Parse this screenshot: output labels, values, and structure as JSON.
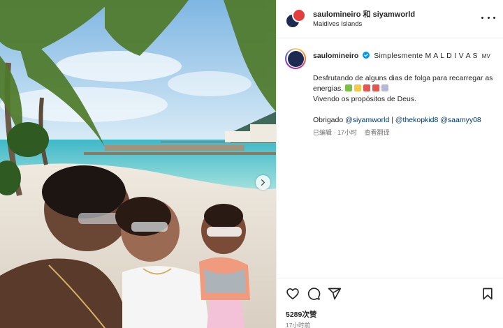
{
  "header": {
    "user1": "saulomineiro",
    "connector": "和",
    "user2": "siyamworld",
    "location": "Maldives Islands"
  },
  "caption": {
    "username": "saulomineiro",
    "title": "Simplesmente M A L D I V A S",
    "title_flag": "MV",
    "line1": "Desfrutando de alguns dias de folga para recarregar as energias.",
    "line2": "Vivendo os propósitos de Deus.",
    "thanks": "Obrigado",
    "mention1": "@siyamworld",
    "separator": "|",
    "mention2": "@thekopkid8",
    "mention3": "@saamyy08",
    "edited": "已编辑",
    "time": "17小时",
    "translate": "查看翻译"
  },
  "emojis": [
    "#7ac142",
    "#f7c948",
    "#e8554e",
    "#e8554e",
    "#b7b7d9"
  ],
  "engagement": {
    "likes": "5289次赞",
    "posted": "17小时前"
  },
  "colors": {
    "mention": "#00376b",
    "verified": "#0095f6",
    "muted": "#737373"
  },
  "icons": [
    "heart-icon",
    "comment-icon",
    "share-icon",
    "bookmark-icon",
    "more-icon",
    "chevron-right-icon",
    "verified-icon"
  ]
}
